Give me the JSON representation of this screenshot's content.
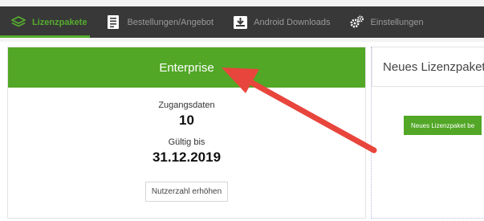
{
  "nav": {
    "items": [
      {
        "label": "Lizenzpakete",
        "icon": "layers-icon",
        "active": true
      },
      {
        "label": "Bestellungen/Angebot",
        "icon": "document-list-icon",
        "active": false
      },
      {
        "label": "Android Downloads",
        "icon": "download-tray-icon",
        "active": false
      },
      {
        "label": "Einstellungen",
        "icon": "gears-icon",
        "active": false
      }
    ]
  },
  "license": {
    "title": "Enterprise",
    "access_label": "Zugangsdaten",
    "access_value": "10",
    "valid_label": "Gültig bis",
    "valid_value": "31.12.2019",
    "increase_button": "Nutzerzahl erhöhen"
  },
  "new_package": {
    "title": "Neues Lizenzpaket",
    "button": "Neues Lizenzpaket be"
  },
  "colors": {
    "accent_green": "#52a726",
    "nav_background": "#383838",
    "annotation_red": "#e8453c"
  }
}
